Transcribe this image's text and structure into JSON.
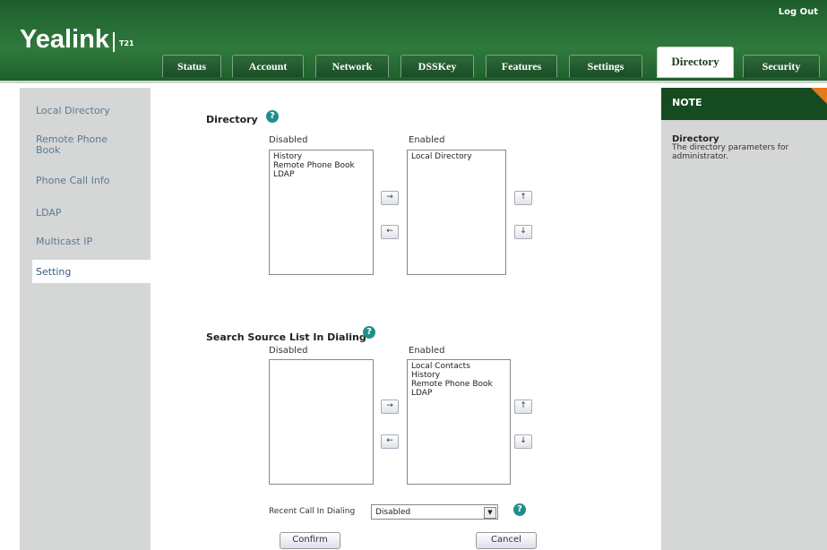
{
  "header": {
    "logout": "Log Out",
    "logo": "Yealink",
    "model": "T21"
  },
  "tabs": [
    {
      "label": "Status"
    },
    {
      "label": "Account"
    },
    {
      "label": "Network"
    },
    {
      "label": "DSSKey"
    },
    {
      "label": "Features"
    },
    {
      "label": "Settings"
    },
    {
      "label": "Directory",
      "active": true
    },
    {
      "label": "Security"
    }
  ],
  "sidebar": {
    "items": [
      {
        "label": "Local Directory"
      },
      {
        "label": "Remote Phone Book"
      },
      {
        "label": "Phone Call Info"
      },
      {
        "label": "LDAP"
      },
      {
        "label": "Multicast IP"
      },
      {
        "label": "Setting",
        "active": true
      }
    ]
  },
  "directory": {
    "title": "Directory",
    "disabled_label": "Disabled",
    "enabled_label": "Enabled",
    "disabled_items": [
      "History",
      "Remote Phone Book",
      "LDAP"
    ],
    "enabled_items": [
      "Local Directory"
    ]
  },
  "search_source": {
    "title": "Search Source List In Dialing",
    "disabled_label": "Disabled",
    "enabled_label": "Enabled",
    "disabled_items": [],
    "enabled_items": [
      "Local Contacts",
      "History",
      "Remote Phone Book",
      "LDAP"
    ]
  },
  "recent_call": {
    "label": "Recent Call In Dialing",
    "value": "Disabled"
  },
  "buttons": {
    "confirm": "Confirm",
    "cancel": "Cancel",
    "move_right": "→",
    "move_left": "←",
    "move_up": "↑",
    "move_down": "↓",
    "help": "?",
    "dropdown": "▼"
  },
  "note": {
    "heading": "NOTE",
    "title": "Directory",
    "text": "The directory parameters for administrator."
  }
}
